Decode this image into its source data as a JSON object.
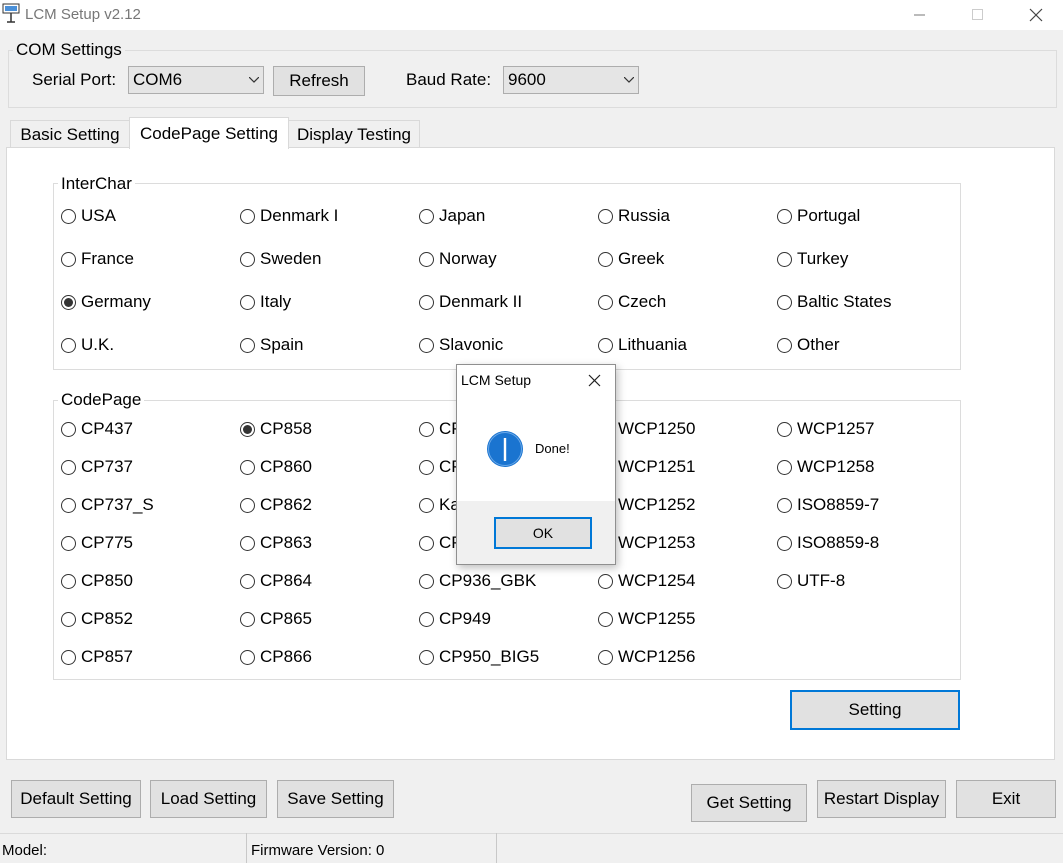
{
  "window": {
    "title": "LCM Setup v2.12"
  },
  "com_settings": {
    "legend": "COM Settings",
    "serial_port_label": "Serial Port:",
    "serial_port_value": "COM6",
    "refresh_label": "Refresh",
    "baud_rate_label": "Baud Rate:",
    "baud_rate_value": "9600"
  },
  "tabs": [
    {
      "label": "Basic Setting"
    },
    {
      "label": "CodePage Setting",
      "active": true
    },
    {
      "label": "Display Testing"
    }
  ],
  "interchar": {
    "legend": "InterChar",
    "selected": "Germany",
    "options": [
      [
        "USA",
        "Denmark I",
        "Japan",
        "Russia",
        "Portugal"
      ],
      [
        "France",
        "Sweden",
        "Norway",
        "Greek",
        "Turkey"
      ],
      [
        "Germany",
        "Italy",
        "Denmark II",
        "Czech",
        "Baltic States"
      ],
      [
        "U.K.",
        "Spain",
        "Slavonic",
        "Lithuania",
        "Other"
      ]
    ]
  },
  "codepage": {
    "legend": "CodePage",
    "selected": "CP858",
    "columns": [
      [
        "CP437",
        "CP737",
        "CP737_S",
        "CP775",
        "CP850",
        "CP852",
        "CP857"
      ],
      [
        "CP858",
        "CP860",
        "CP862",
        "CP863",
        "CP864",
        "CP865",
        "CP866"
      ],
      [
        "CP",
        "CP",
        "Ka",
        "CP",
        "CP936_GBK",
        "CP949",
        "CP950_BIG5"
      ],
      [
        "WCP1250",
        "WCP1251",
        "WCP1252",
        "WCP1253",
        "WCP1254",
        "WCP1255",
        "WCP1256"
      ],
      [
        "WCP1257",
        "WCP1258",
        "ISO8859-7",
        "ISO8859-8",
        "UTF-8"
      ]
    ]
  },
  "setting_button": "Setting",
  "bottom_buttons": {
    "default_setting": "Default Setting",
    "load_setting": "Load Setting",
    "save_setting": "Save Setting",
    "get_setting": "Get Setting",
    "restart_display": "Restart Display",
    "exit": "Exit"
  },
  "status_bar": {
    "model": "Model:",
    "firmware": "Firmware Version: 0"
  },
  "dialog": {
    "title": "LCM Setup",
    "message": "Done!",
    "ok_label": "OK",
    "icon": "info-icon"
  },
  "colors": {
    "accent": "#0078d7",
    "info_blue": "#1a74d0",
    "background": "#f0f0f0"
  }
}
